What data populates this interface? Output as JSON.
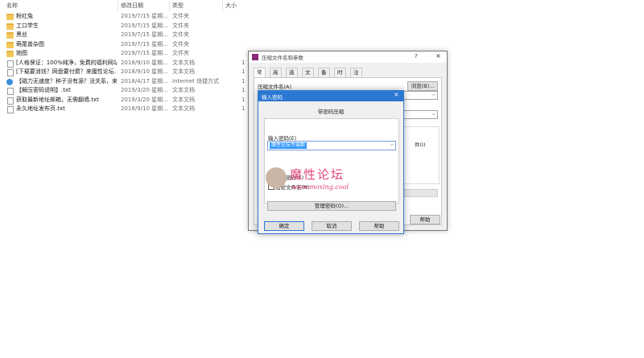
{
  "explorer": {
    "columns": {
      "name": "名称",
      "date": "修改日期",
      "type": "类型",
      "size": "大小"
    },
    "files": [
      {
        "name": "粉红兔",
        "date": "2019/7/15 星期...",
        "type": "文件夹",
        "size": "",
        "icon": "folder-icon"
      },
      {
        "name": "工口学生",
        "date": "2019/7/15 星期...",
        "type": "文件夹",
        "size": "",
        "icon": "folder-icon"
      },
      {
        "name": "黑丝",
        "date": "2019/7/15 星期...",
        "type": "文件夹",
        "size": "",
        "icon": "folder-icon"
      },
      {
        "name": "萌尾兽杂图",
        "date": "2019/7/15 星期...",
        "type": "文件夹",
        "size": "",
        "icon": "folder-icon"
      },
      {
        "name": "她图",
        "date": "2019/7/15 星期...",
        "type": "文件夹",
        "size": "",
        "icon": "folder-icon"
      },
      {
        "name": "[人格保证：100%纯净，免费的福利网站...",
        "date": "2018/9/10 星期...",
        "type": "文本文档",
        "size": "1",
        "icon": "text-file-icon"
      },
      {
        "name": "[下载要消钱？网盘要付费？来魔性论坛...",
        "date": "2018/9/10 星期...",
        "type": "文本文档",
        "size": "1",
        "icon": "text-file-icon"
      },
      {
        "name": "【磁力无速度？种子没有源？没关系，来...",
        "date": "2018/4/17 星期...",
        "type": "Internet 快捷方式",
        "size": "1",
        "icon": "internet-shortcut-icon"
      },
      {
        "name": "【解压密码说明】.txt",
        "date": "2019/3/20 星期...",
        "type": "文本文档",
        "size": "1",
        "icon": "text-file-icon"
      },
      {
        "name": "获取最新地址邮箱，无需翻墙.txt",
        "date": "2019/3/20 星期...",
        "type": "文本文档",
        "size": "1",
        "icon": "text-file-icon"
      },
      {
        "name": "永久地址发布页.txt",
        "date": "2018/9/10 星期...",
        "type": "文本文档",
        "size": "1",
        "icon": "text-file-icon"
      }
    ]
  },
  "archive_dialog": {
    "title": "压缩文件名和参数",
    "help_glyph": "?",
    "close_glyph": "×",
    "tabs": [
      "常规",
      "高级",
      "选项",
      "文件",
      "备份",
      "时间",
      "注释"
    ],
    "archive_name_label": "压缩文件名(A)",
    "browse_label": "浏览(B)...",
    "partial_text": "件(I)",
    "help_button": "帮助"
  },
  "password_dialog": {
    "title": "输入密码",
    "close_glyph": "×",
    "subtitle": "带密码压缩",
    "password_label": "输入密码(E)",
    "password_value": "魔性论坛专属群",
    "show_password_label": "显示密码(S)",
    "encrypt_names_label": "加密文件名(N)",
    "manage_label": "管理密码(O)...",
    "ok": "确定",
    "cancel": "取消",
    "help": "帮助"
  },
  "watermark": {
    "text": "魔性论坛",
    "url": "www.moxing.cool"
  }
}
